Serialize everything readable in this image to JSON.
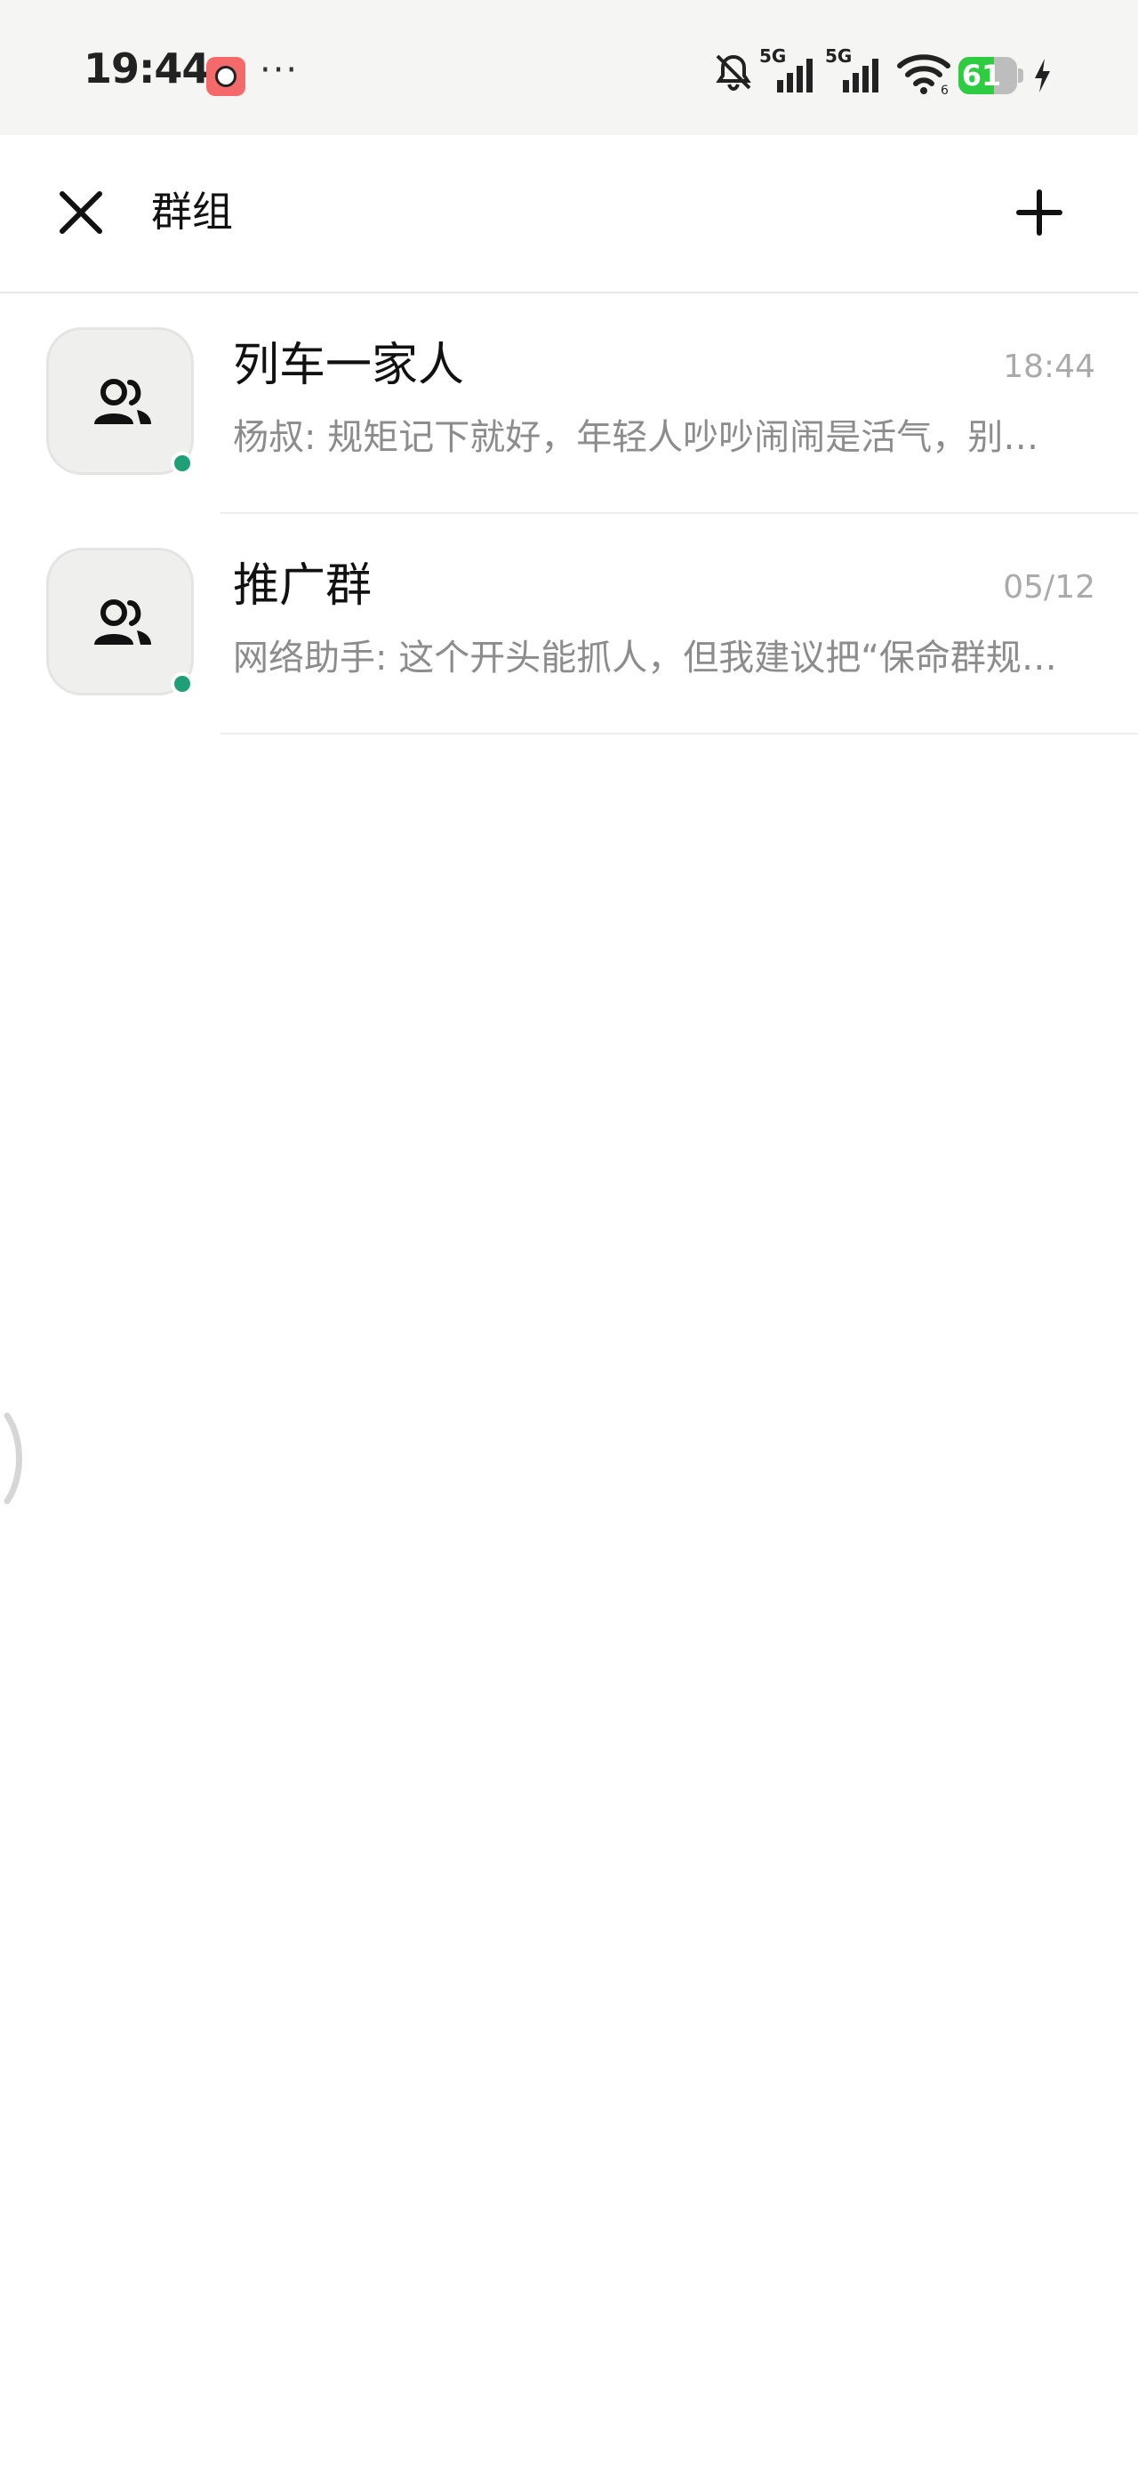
{
  "status_bar": {
    "time": "19:44",
    "more": "···",
    "battery_level": "61",
    "battery_fraction": 0.61,
    "network": [
      "5G",
      "5G"
    ],
    "icons": [
      "notification-muted-icon",
      "signal-5g-icon",
      "signal-5g-icon",
      "wifi-icon",
      "battery-icon",
      "charging-icon"
    ]
  },
  "header": {
    "title": "群组"
  },
  "groups": [
    {
      "name": "列车一家人",
      "time": "18:44",
      "preview": "杨叔: 规矩记下就好，年轻人吵吵闹闹是活气，别…",
      "online": true
    },
    {
      "name": "推广群",
      "time": "05/12",
      "preview": "网络助手: 这个开头能抓人，但我建议把“保命群规…",
      "online": true
    }
  ],
  "colors": {
    "online": "#1e9f75",
    "battery": "#2ecc40",
    "status_bg": "#f5f5f3"
  }
}
